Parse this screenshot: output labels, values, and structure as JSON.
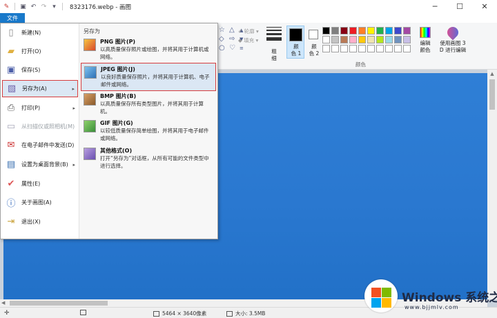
{
  "window": {
    "title": "8323176.webp - 画图",
    "min_glyph": "─",
    "max_glyph": "☐",
    "close_glyph": "✕"
  },
  "tabs": {
    "file": "文件"
  },
  "ribbon": {
    "outline_label": "轮廓",
    "fill_label": "填充",
    "thickness_label": "粗\n细",
    "color1_label": "颜\n色 1",
    "color2_label": "颜\n色 2",
    "colors_group_label": "颜色",
    "edit_colors_label": "编辑\n颜色",
    "paint3d_label": "使用画图 3\nD 进行编辑",
    "color1": "#000000",
    "color2": "#ffffff",
    "palette": [
      "#000000",
      "#7f7f7f",
      "#880015",
      "#ed1c24",
      "#ff7f27",
      "#fff200",
      "#22b14c",
      "#00a2e8",
      "#3f48cc",
      "#a349a4",
      "#ffffff",
      "#c3c3c3",
      "#b97a57",
      "#ffaec9",
      "#ffc90e",
      "#efe4b0",
      "#b5e61d",
      "#99d9ea",
      "#7092be",
      "#c8bfe7",
      "#ffffff",
      "#ffffff",
      "#ffffff",
      "#ffffff",
      "#ffffff",
      "#ffffff",
      "#ffffff",
      "#ffffff",
      "#ffffff",
      "#ffffff"
    ]
  },
  "file_menu": {
    "left_items": [
      {
        "label": "新建(N)",
        "icon": "new-file-icon"
      },
      {
        "label": "打开(O)",
        "icon": "open-folder-icon"
      },
      {
        "label": "保存(S)",
        "icon": "save-icon"
      },
      {
        "label": "另存为(A)",
        "icon": "save-as-icon",
        "active": true,
        "submenu": true
      },
      {
        "label": "打印(P)",
        "icon": "printer-icon",
        "submenu": true
      },
      {
        "label": "从扫描仪或照相机(M)",
        "icon": "scanner-icon",
        "disabled": true
      },
      {
        "label": "在电子邮件中发送(D)",
        "icon": "email-icon"
      },
      {
        "label": "设置为桌面背景(B)",
        "icon": "desktop-icon",
        "submenu": true
      },
      {
        "label": "属性(E)",
        "icon": "checkmark-icon"
      },
      {
        "label": "关于画图(A)",
        "icon": "info-icon"
      },
      {
        "label": "退出(X)",
        "icon": "exit-icon"
      }
    ],
    "save_as_heading": "另存为",
    "save_as_items": [
      {
        "title": "PNG 图片(P)",
        "desc": "以高质量保存照片或绘图，并将其用于计算机或网络。",
        "icon": "png-image-icon"
      },
      {
        "title": "JPEG 图片(J)",
        "desc": "以良好质量保存照片，并将其用于计算机、电子邮件或网络。",
        "icon": "jpeg-image-icon",
        "active": true
      },
      {
        "title": "BMP 图片(B)",
        "desc": "以高质量保存所有类型图片，并将其用于计算机。",
        "icon": "bmp-image-icon"
      },
      {
        "title": "GIF 图片(G)",
        "desc": "以较低质量保存简单绘图，并将其用于电子邮件或网络。",
        "icon": "gif-image-icon"
      },
      {
        "title": "其他格式(O)",
        "desc": "打开“另存为”对话框，从所有可能的文件类型中进行选择。",
        "icon": "other-formats-icon"
      }
    ]
  },
  "status": {
    "dimensions": "5464 × 3640像素",
    "size": "大小: 3.5MB"
  },
  "watermark": {
    "text": "Windows 系统之家",
    "url": "www.bjjmlv.com"
  }
}
